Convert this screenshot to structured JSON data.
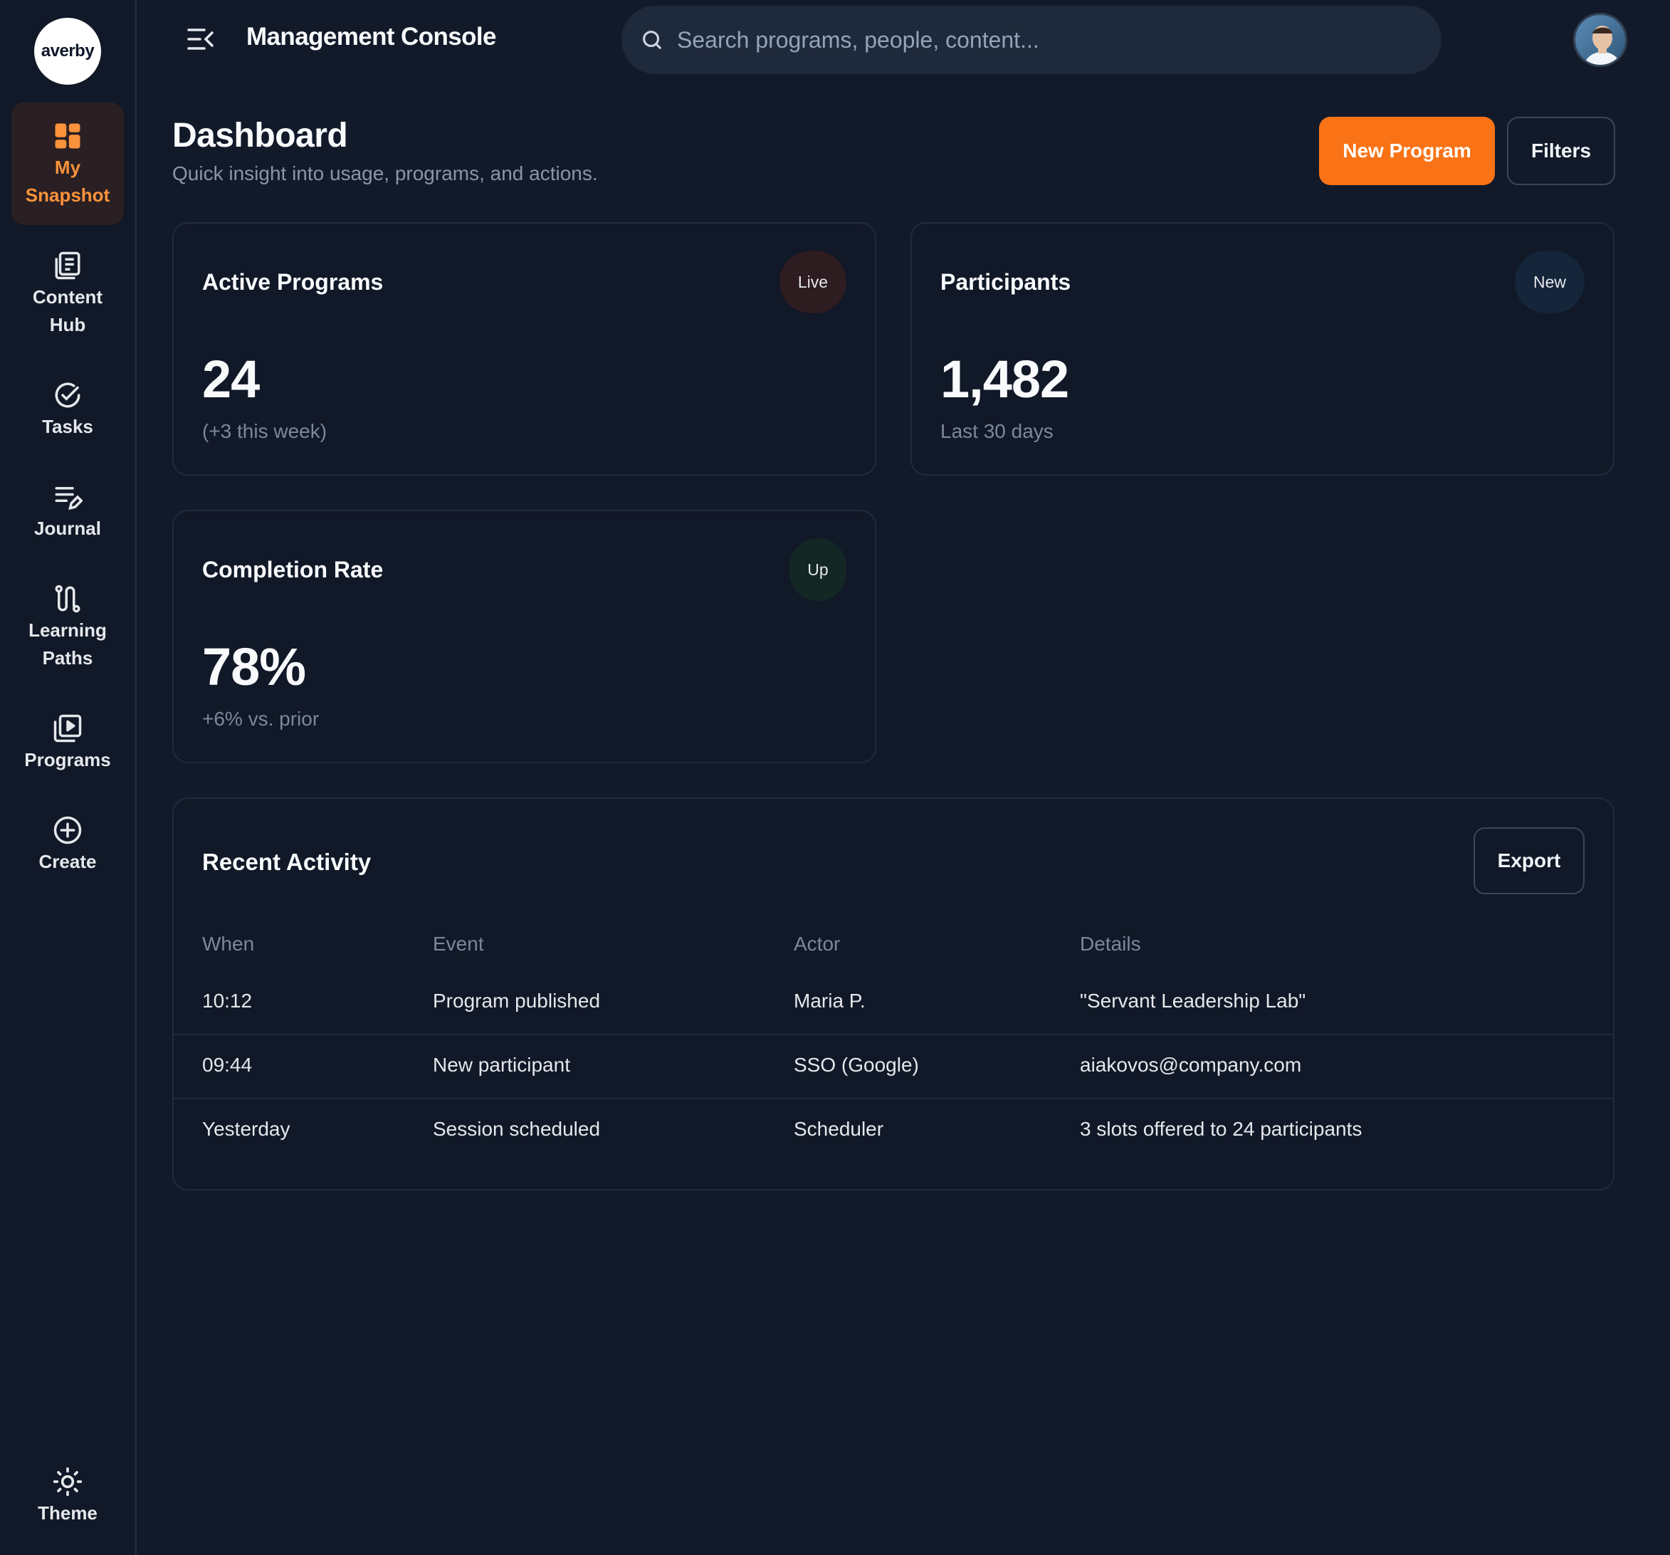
{
  "brand": {
    "logo_text": "averby"
  },
  "sidebar": {
    "items": [
      {
        "label": "My\nSnapshot",
        "icon": "dashboard-grid-icon",
        "active": true
      },
      {
        "label": "Content\nHub",
        "icon": "content-hub-icon"
      },
      {
        "label": "Tasks",
        "icon": "check-circle-icon"
      },
      {
        "label": "Journal",
        "icon": "journal-pencil-icon"
      },
      {
        "label": "Learning\nPaths",
        "icon": "path-icon"
      },
      {
        "label": "Programs",
        "icon": "play-stack-icon"
      },
      {
        "label": "Create",
        "icon": "plus-circle-icon"
      }
    ],
    "theme": {
      "label": "Theme",
      "icon": "sun-icon"
    }
  },
  "topbar": {
    "title": "Management Console",
    "search_placeholder": "Search programs, people, content..."
  },
  "header": {
    "title": "Dashboard",
    "subtitle": "Quick insight into usage, programs, and actions.",
    "new_program": "New Program",
    "filters": "Filters"
  },
  "cards": {
    "active": {
      "title": "Active Programs",
      "badge": "Live",
      "value": "24",
      "note": "(+3 this week)"
    },
    "participants": {
      "title": "Participants",
      "badge": "New",
      "value": "1,482",
      "note": "Last 30 days"
    },
    "completion": {
      "title": "Completion Rate",
      "badge": "Up",
      "value": "78%",
      "note": "+6% vs. prior"
    }
  },
  "activity": {
    "title": "Recent Activity",
    "export": "Export",
    "columns": [
      "When",
      "Event",
      "Actor",
      "Details"
    ],
    "rows": [
      [
        "10:12",
        "Program published",
        "Maria P.",
        "\"Servant Leadership Lab\""
      ],
      [
        "09:44",
        "New participant",
        "SSO (Google)",
        "aiakovos@company.com"
      ],
      [
        "Yesterday",
        "Session scheduled",
        "Scheduler",
        "3 slots offered to 24 participants"
      ]
    ]
  },
  "colors": {
    "accent": "#f97316",
    "background": "#121a2a",
    "card": "#111827"
  }
}
